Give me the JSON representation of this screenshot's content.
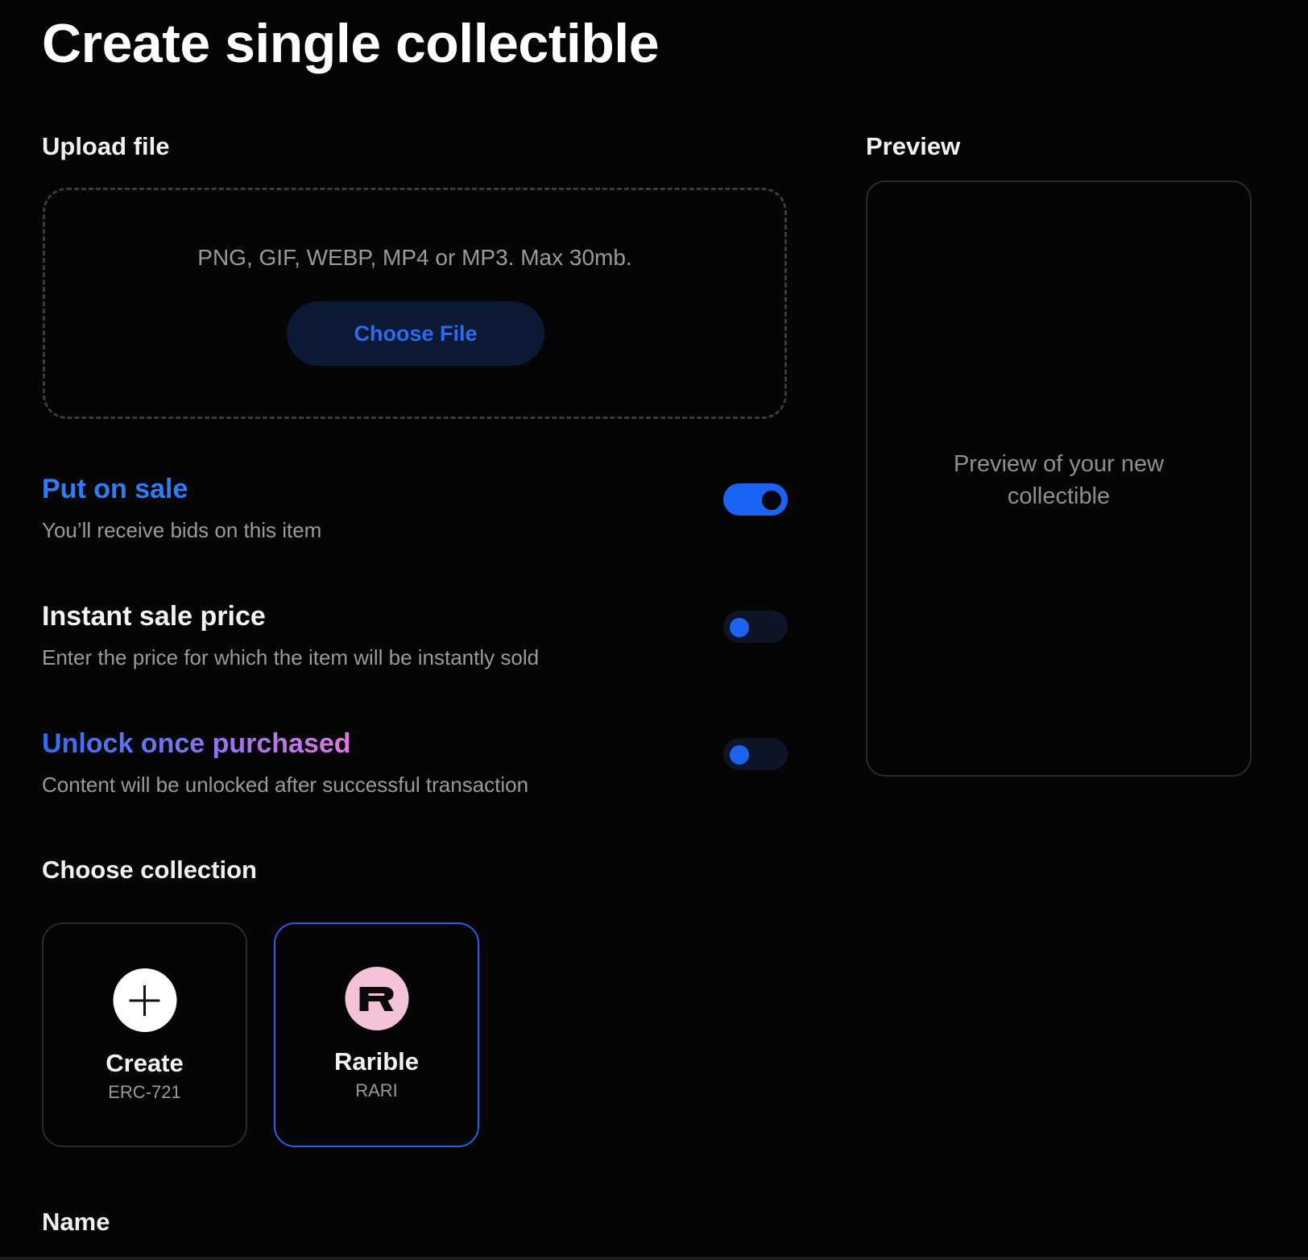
{
  "page": {
    "title": "Create single collectible"
  },
  "upload": {
    "label": "Upload file",
    "hint": "PNG, GIF, WEBP, MP4 or MP3. Max 30mb.",
    "button_label": "Choose File"
  },
  "preview": {
    "label": "Preview",
    "placeholder": "Preview of your new collectible"
  },
  "settings": [
    {
      "title": "Put on sale",
      "description": "You’ll receive bids on this item",
      "enabled": true
    },
    {
      "title": "Instant sale price",
      "description": "Enter the price for which the item will be instantly sold",
      "enabled": false
    },
    {
      "title": "Unlock once purchased",
      "description": "Content will be unlocked after successful transaction",
      "enabled": false
    }
  ],
  "collection": {
    "label": "Choose collection",
    "options": [
      {
        "name": "Create",
        "subtitle": "ERC-721",
        "icon": "plus-icon",
        "selected": false
      },
      {
        "name": "Rarible",
        "subtitle": "RARI",
        "icon": "rarible-logo-icon",
        "selected": true
      }
    ]
  },
  "name_field": {
    "label": "Name"
  },
  "colors": {
    "background": "#050505",
    "accent_blue": "#1b63f5",
    "link_blue": "#2f7cf6",
    "button_bg": "#0c1934",
    "rarible_pink": "#f5c3d9",
    "gradient_start": "#2d6ff6",
    "gradient_end": "#e278e6"
  }
}
